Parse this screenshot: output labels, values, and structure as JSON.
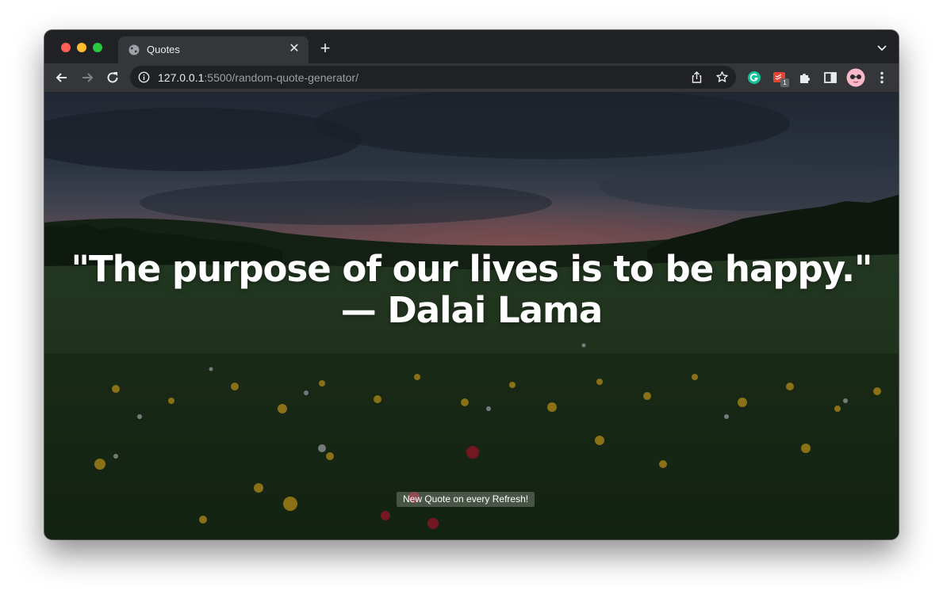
{
  "browser": {
    "tab": {
      "title": "Quotes"
    },
    "omnibox": {
      "url_host": "127.0.0.1",
      "url_rest": ":5500/random-quote-generator/"
    },
    "extensions": [
      "grammarly-icon",
      "todoist-icon",
      "puzzle-extensions-icon",
      "side-panel-icon",
      "profile-avatar",
      "kebab-menu-icon"
    ],
    "extension_badge": "1"
  },
  "page": {
    "quote_text": "\"The purpose of our lives is to be happy.\"",
    "quote_author": "— Dalai Lama",
    "refresh_note": "New Quote on every Refresh!"
  },
  "colors": {
    "window_frame": "#202124",
    "toolbar": "#35363a",
    "quote_text": "#ffffff"
  }
}
